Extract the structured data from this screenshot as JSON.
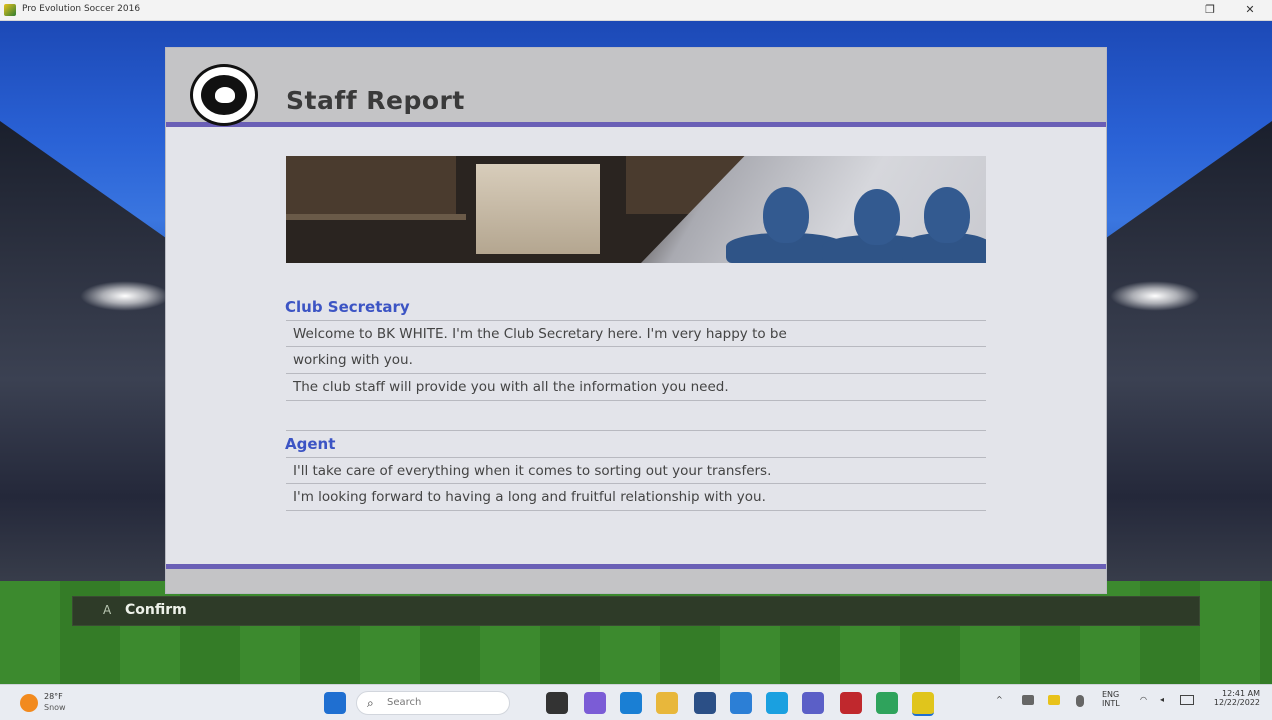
{
  "window": {
    "title": "Pro Evolution Soccer 2016"
  },
  "panel": {
    "title": "Staff Report"
  },
  "sections": [
    {
      "title": "Club Secretary",
      "lines": [
        "Welcome to BK WHITE. I'm the Club Secretary here. I'm very happy to be",
        "working with you.",
        "The club staff will provide you with all the information you need."
      ]
    },
    {
      "title": "Agent",
      "lines": [
        "I'll take care of everything when it comes to sorting out your transfers.",
        "I'm looking forward to having a long and fruitful relationship with you."
      ]
    }
  ],
  "confirm": {
    "key": "A",
    "label": "Confirm"
  },
  "taskbar": {
    "weather_temp": "28°F",
    "weather_desc": "Snow",
    "search_placeholder": "Search",
    "lang_line1": "ENG",
    "lang_line2": "INTL",
    "time": "12:41 AM",
    "date": "12/22/2022"
  },
  "colors": {
    "accent": "#6a5fb6",
    "section_title": "#3c54c4",
    "confirm_bar": "#2e3b28"
  }
}
